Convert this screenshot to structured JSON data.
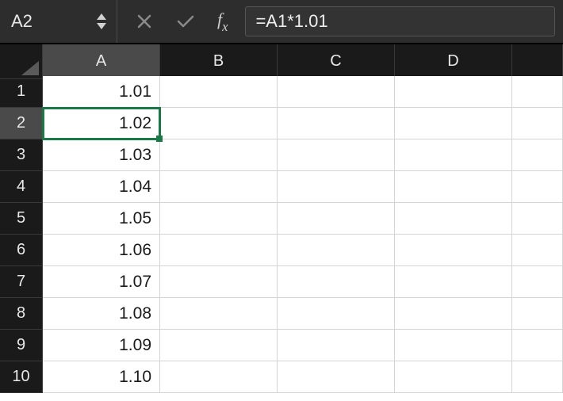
{
  "nameBox": "A2",
  "formula": "=A1*1.01",
  "columns": [
    "A",
    "B",
    "C",
    "D",
    ""
  ],
  "activeColumn": "A",
  "activeRow": 2,
  "rows": [
    {
      "n": 1,
      "cells": [
        "1.01",
        "",
        "",
        "",
        ""
      ]
    },
    {
      "n": 2,
      "cells": [
        "1.02",
        "",
        "",
        "",
        ""
      ]
    },
    {
      "n": 3,
      "cells": [
        "1.03",
        "",
        "",
        "",
        ""
      ]
    },
    {
      "n": 4,
      "cells": [
        "1.04",
        "",
        "",
        "",
        ""
      ]
    },
    {
      "n": 5,
      "cells": [
        "1.05",
        "",
        "",
        "",
        ""
      ]
    },
    {
      "n": 6,
      "cells": [
        "1.06",
        "",
        "",
        "",
        ""
      ]
    },
    {
      "n": 7,
      "cells": [
        "1.07",
        "",
        "",
        "",
        ""
      ]
    },
    {
      "n": 8,
      "cells": [
        "1.08",
        "",
        "",
        "",
        ""
      ]
    },
    {
      "n": 9,
      "cells": [
        "1.09",
        "",
        "",
        "",
        ""
      ]
    },
    {
      "n": 10,
      "cells": [
        "1.10",
        "",
        "",
        "",
        ""
      ]
    }
  ],
  "selectedCell": {
    "row": 2,
    "col": 0
  }
}
